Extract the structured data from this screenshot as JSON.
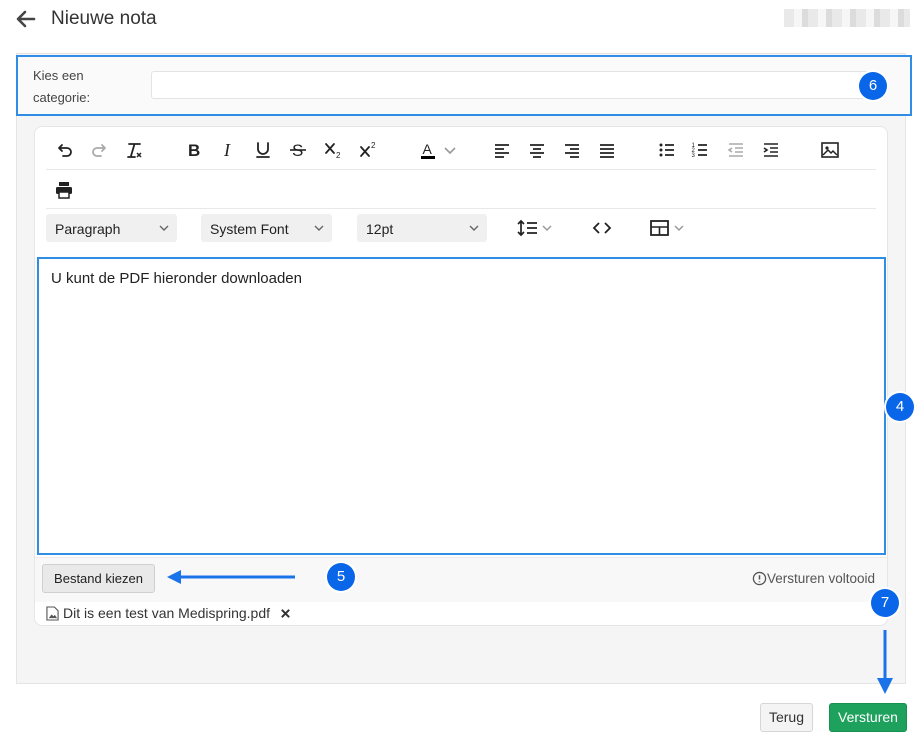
{
  "header": {
    "title": "Nieuwe nota",
    "back_icon": "arrow-left-icon"
  },
  "category": {
    "label": "Kies een categorie:",
    "value": "",
    "placeholder": ""
  },
  "callouts": [
    "6",
    "4",
    "5",
    "7"
  ],
  "toolbar": {
    "row1_icons": [
      "undo-icon",
      "redo-icon",
      "clear-format-icon",
      "bold-icon",
      "italic-icon",
      "underline-icon",
      "strikethrough-icon",
      "subscript-icon",
      "superscript-icon",
      "text-color-icon",
      "align-left-icon",
      "align-center-icon",
      "align-right-icon",
      "justify-icon",
      "bullet-list-icon",
      "numbered-list-icon",
      "outdent-icon",
      "indent-icon",
      "image-icon"
    ],
    "row2_icons": [
      "print-icon"
    ],
    "block_format": "Paragraph",
    "font_family": "System Font",
    "font_size": "12pt",
    "row3_icons": [
      "line-height-icon",
      "source-code-icon",
      "table-icon"
    ]
  },
  "editor": {
    "content": "U kunt de PDF hieronder downloaden"
  },
  "footer": {
    "choose_file": "Bestand kiezen",
    "status": "Versturen voltooid"
  },
  "attachment": {
    "name": "Dit is een test van Medispring.pdf"
  },
  "actions": {
    "back": "Terug",
    "send": "Versturen"
  },
  "colors": {
    "accent_blue": "#2f8de4",
    "badge_blue": "#0a66e8",
    "send_green": "#1fa15e",
    "text_color_underline": "#000000"
  }
}
